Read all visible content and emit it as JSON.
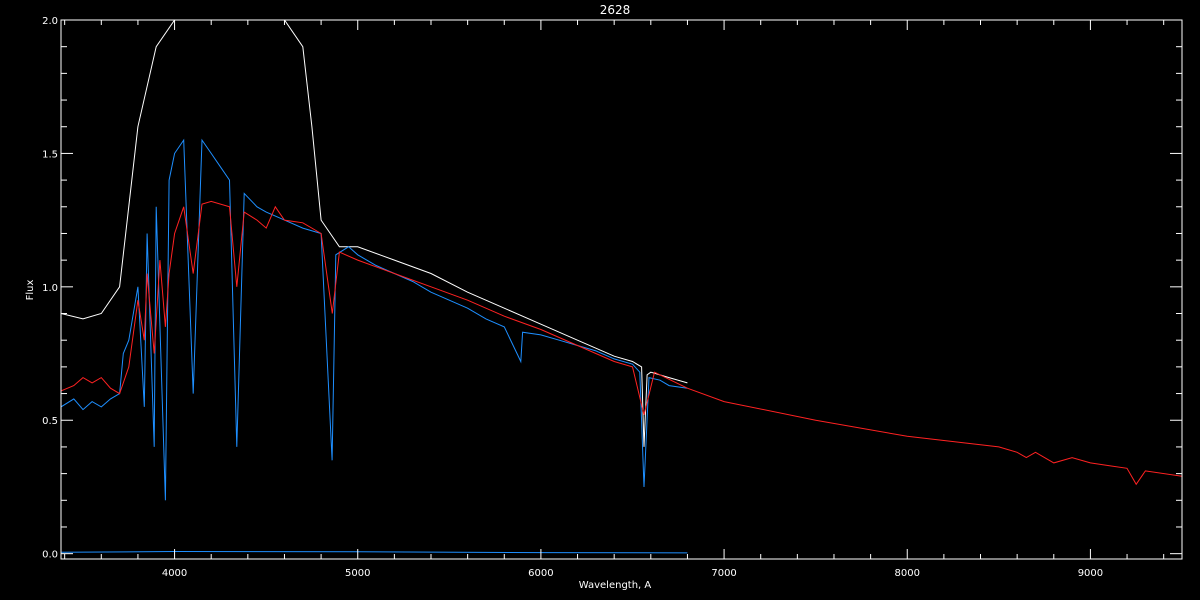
{
  "chart_data": {
    "type": "line",
    "title": "2628",
    "xlabel": "Wavelength, A",
    "ylabel": "Flux",
    "xlim": [
      3380,
      9500
    ],
    "ylim": [
      -0.02,
      2.0
    ],
    "x_ticks": [
      4000,
      5000,
      6000,
      7000,
      8000,
      9000
    ],
    "x_tick_labels": [
      "4000",
      "5000",
      "6000",
      "7000",
      "8000",
      "9000"
    ],
    "y_ticks": [
      0.0,
      0.5,
      1.0,
      1.5,
      2.0
    ],
    "y_tick_labels": [
      "0.0",
      "0.5",
      "1.0",
      "1.5",
      "2.0"
    ],
    "background": "#000000",
    "axis_color": "#ffffff",
    "series": [
      {
        "color": "#ffffff",
        "x": [
          3380,
          3500,
          3600,
          3700,
          3800,
          3900,
          4000,
          4100,
          4200,
          4300,
          4400,
          4500,
          4600,
          4700,
          4750,
          4800,
          4850,
          4900,
          5000,
          5200,
          5400,
          5600,
          5800,
          6000,
          6200,
          6400,
          6500,
          6550,
          6563,
          6580,
          6600,
          6700,
          6800
        ],
        "y": [
          0.9,
          0.88,
          0.9,
          1.0,
          1.6,
          1.9,
          2.0,
          2.0,
          2.0,
          2.0,
          2.0,
          2.0,
          2.0,
          1.9,
          1.6,
          1.25,
          1.2,
          1.15,
          1.15,
          1.1,
          1.05,
          0.98,
          0.92,
          0.86,
          0.8,
          0.74,
          0.72,
          0.7,
          0.4,
          0.67,
          0.68,
          0.66,
          0.64
        ]
      },
      {
        "color": "#1e8fff",
        "x": [
          3380,
          3450,
          3500,
          3550,
          3600,
          3650,
          3700,
          3720,
          3750,
          3800,
          3835,
          3850,
          3889,
          3900,
          3950,
          3970,
          4000,
          4050,
          4102,
          4150,
          4200,
          4250,
          4300,
          4340,
          4380,
          4450,
          4500,
          4600,
          4700,
          4800,
          4860,
          4880,
          4950,
          5000,
          5100,
          5200,
          5300,
          5400,
          5500,
          5600,
          5700,
          5800,
          5890,
          5900,
          6000,
          6100,
          6200,
          6300,
          6400,
          6500,
          6540,
          6563,
          6590,
          6650,
          6700,
          6800
        ],
        "y": [
          0.55,
          0.58,
          0.54,
          0.57,
          0.55,
          0.58,
          0.6,
          0.75,
          0.8,
          1.0,
          0.55,
          1.2,
          0.4,
          1.3,
          0.2,
          1.4,
          1.5,
          1.55,
          0.6,
          1.55,
          1.5,
          1.45,
          1.4,
          0.4,
          1.35,
          1.3,
          1.28,
          1.25,
          1.22,
          1.2,
          0.35,
          1.12,
          1.15,
          1.12,
          1.08,
          1.05,
          1.02,
          0.98,
          0.95,
          0.92,
          0.88,
          0.85,
          0.72,
          0.83,
          0.82,
          0.8,
          0.78,
          0.76,
          0.73,
          0.71,
          0.68,
          0.25,
          0.66,
          0.65,
          0.63,
          0.62
        ]
      },
      {
        "color": "#ff2222",
        "x": [
          3380,
          3450,
          3500,
          3550,
          3600,
          3650,
          3700,
          3750,
          3800,
          3835,
          3850,
          3889,
          3920,
          3950,
          3970,
          4000,
          4050,
          4102,
          4150,
          4200,
          4300,
          4340,
          4380,
          4450,
          4500,
          4550,
          4600,
          4700,
          4800,
          4861,
          4900,
          5000,
          5200,
          5400,
          5600,
          5800,
          6000,
          6200,
          6400,
          6500,
          6563,
          6620,
          6800,
          7000,
          7500,
          8000,
          8500,
          8600,
          8650,
          8700,
          8800,
          8900,
          9000,
          9100,
          9200,
          9250,
          9300,
          9500
        ],
        "y": [
          0.61,
          0.63,
          0.66,
          0.64,
          0.66,
          0.62,
          0.6,
          0.7,
          0.95,
          0.8,
          1.05,
          0.75,
          1.1,
          0.85,
          1.05,
          1.2,
          1.3,
          1.05,
          1.31,
          1.32,
          1.3,
          1.0,
          1.28,
          1.25,
          1.22,
          1.3,
          1.25,
          1.24,
          1.2,
          0.9,
          1.13,
          1.1,
          1.05,
          1.0,
          0.95,
          0.89,
          0.84,
          0.78,
          0.72,
          0.7,
          0.52,
          0.68,
          0.62,
          0.57,
          0.5,
          0.44,
          0.4,
          0.38,
          0.36,
          0.38,
          0.34,
          0.36,
          0.34,
          0.33,
          0.32,
          0.26,
          0.31,
          0.29
        ]
      },
      {
        "color": "#1e8fff",
        "x": [
          3380,
          4000,
          5000,
          6000,
          6800
        ],
        "y": [
          0.005,
          0.008,
          0.007,
          0.004,
          0.003
        ]
      }
    ]
  }
}
